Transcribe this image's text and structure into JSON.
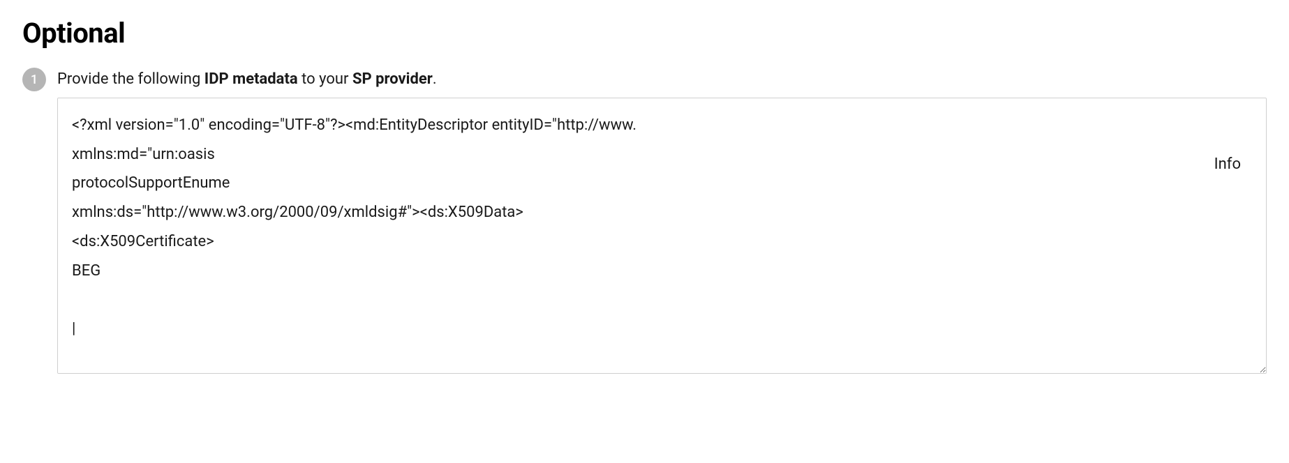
{
  "section": {
    "title": "Optional"
  },
  "step": {
    "number": "1",
    "instruction_prefix": "Provide the following ",
    "instruction_bold1": "IDP metadata",
    "instruction_mid": " to your ",
    "instruction_bold2": "SP provider",
    "instruction_suffix": "."
  },
  "metadata": {
    "info_label": "Info",
    "content": "<?xml version=\"1.0\" encoding=\"UTF-8\"?><md:EntityDescriptor entityID=\"http://www.\nxmlns:md=\"urn:oasis\nprotocolSupportEnume\nxmlns:ds=\"http://www.w3.org/2000/09/xmldsig#\"><ds:X509Data>\n<ds:X509Certificate>\nBEG\n\n|\n\n"
  }
}
